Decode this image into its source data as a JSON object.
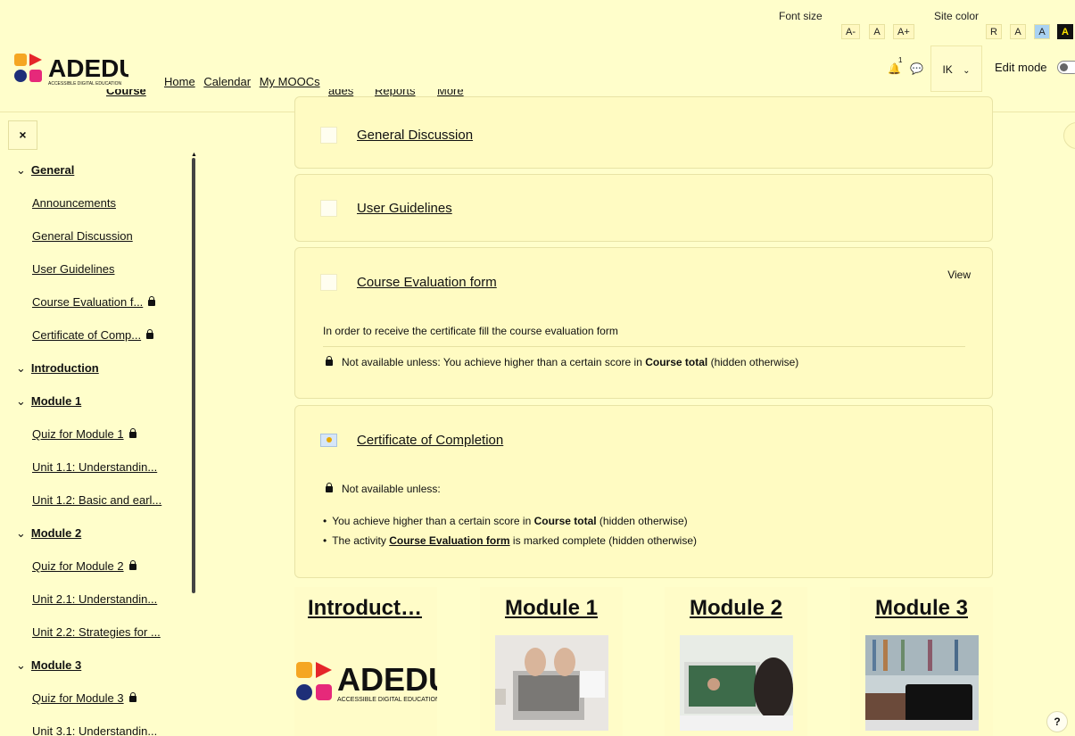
{
  "accessibility": {
    "font_size_label": "Font size",
    "font_size_buttons": [
      "A-",
      "A",
      "A+"
    ],
    "site_color_label": "Site color",
    "site_color_buttons": [
      "R",
      "A",
      "A",
      "A"
    ]
  },
  "header": {
    "logo_text": "ADEDU",
    "logo_subtitle": "ACCESSIBLE DIGITAL EDUCATION",
    "nav": [
      "Home",
      "Calendar",
      "My MOOCs"
    ],
    "notification_count": "1",
    "user_initials": "IK",
    "edit_mode_label": "Edit mode"
  },
  "secondary_nav": {
    "items": [
      "Course",
      "ades",
      "Reports",
      "More"
    ]
  },
  "sidebar": {
    "close_label": "×",
    "entries": [
      {
        "type": "section",
        "label": "General"
      },
      {
        "type": "item",
        "label": "Announcements",
        "locked": false
      },
      {
        "type": "item",
        "label": "General Discussion",
        "locked": false
      },
      {
        "type": "item",
        "label": "User Guidelines",
        "locked": false
      },
      {
        "type": "item",
        "label": "Course Evaluation f...",
        "locked": true
      },
      {
        "type": "item",
        "label": "Certificate of Comp...",
        "locked": true
      },
      {
        "type": "section",
        "label": "Introduction"
      },
      {
        "type": "section",
        "label": "Module 1"
      },
      {
        "type": "item",
        "label": "Quiz for Module 1",
        "locked": true
      },
      {
        "type": "item",
        "label": "Unit 1.1: Understandin...",
        "locked": false
      },
      {
        "type": "item",
        "label": "Unit 1.2: Basic and earl...",
        "locked": false
      },
      {
        "type": "section",
        "label": "Module 2"
      },
      {
        "type": "item",
        "label": "Quiz for Module 2",
        "locked": true
      },
      {
        "type": "item",
        "label": "Unit 2.1: Understandin...",
        "locked": false
      },
      {
        "type": "item",
        "label": "Unit 2.2: Strategies for ...",
        "locked": false
      },
      {
        "type": "section",
        "label": "Module 3"
      },
      {
        "type": "item",
        "label": "Quiz for Module 3",
        "locked": true
      },
      {
        "type": "item",
        "label": "Unit 3.1: Understandin...",
        "locked": false
      }
    ]
  },
  "main": {
    "general_discussion": "General Discussion",
    "user_guidelines": "User Guidelines",
    "course_eval": {
      "title": "Course Evaluation form",
      "view_label": "View",
      "description": "In order to receive the certificate fill the course evaluation form",
      "restriction_prefix": "Not available unless: You achieve higher than a certain score in ",
      "restriction_bold": "Course total",
      "restriction_suffix": " (hidden otherwise)"
    },
    "certificate": {
      "title": "Certificate of Completion",
      "restriction_heading": "Not available unless:",
      "condition1_prefix": "You achieve higher than a certain score in ",
      "condition1_bold": "Course total",
      "condition1_suffix": " (hidden otherwise)",
      "condition2_prefix": "The activity ",
      "condition2_link": "Course Evaluation form",
      "condition2_suffix": " is marked complete (hidden otherwise)"
    }
  },
  "tiles": [
    {
      "title": "Introduct…"
    },
    {
      "title": "Module 1"
    },
    {
      "title": "Module 2"
    },
    {
      "title": "Module 3"
    }
  ],
  "help_label": "?"
}
